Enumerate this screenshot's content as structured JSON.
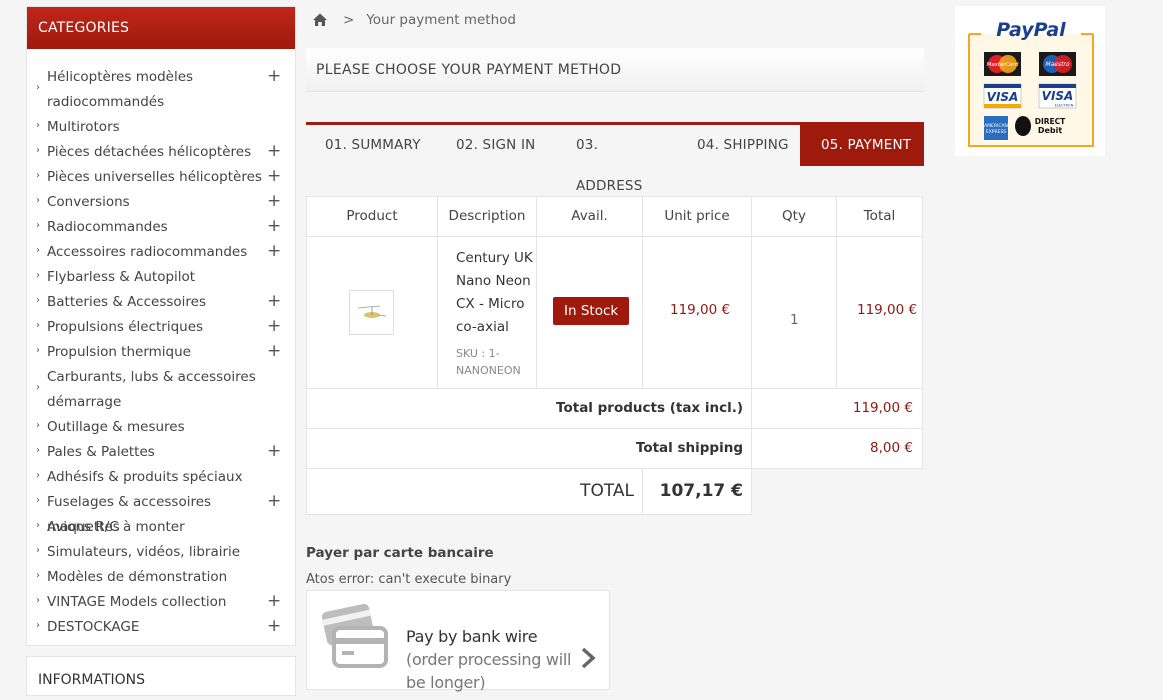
{
  "sidebar": {
    "categories_title": "CATEGORIES",
    "items": [
      {
        "label_lines": [
          "Hélicoptères modèles",
          "radiocommandés"
        ],
        "has_children": true
      },
      {
        "label_lines": [
          "Multirotors"
        ],
        "has_children": false
      },
      {
        "label_lines": [
          "Pièces détachées hélicoptères"
        ],
        "has_children": true
      },
      {
        "label_lines": [
          "Pièces universelles hélicoptères"
        ],
        "has_children": true
      },
      {
        "label_lines": [
          "Conversions"
        ],
        "has_children": true
      },
      {
        "label_lines": [
          "Radiocommandes"
        ],
        "has_children": true
      },
      {
        "label_lines": [
          "Accessoires radiocommandes"
        ],
        "has_children": true
      },
      {
        "label_lines": [
          "Flybarless & Autopilot"
        ],
        "has_children": false
      },
      {
        "label_lines": [
          "Batteries & Accessoires"
        ],
        "has_children": true
      },
      {
        "label_lines": [
          "Propulsions électriques"
        ],
        "has_children": true
      },
      {
        "label_lines": [
          "Propulsion thermique"
        ],
        "has_children": true
      },
      {
        "label_lines": [
          "Carburants, lubs & accessoires",
          "démarrage"
        ],
        "has_children": false
      },
      {
        "label_lines": [
          "Outillage & mesures"
        ],
        "has_children": false
      },
      {
        "label_lines": [
          "Pales & Palettes"
        ],
        "has_children": true
      },
      {
        "label_lines": [
          "Adhésifs & produits spéciaux"
        ],
        "has_children": false
      },
      {
        "label_lines": [
          "Fuselages & accessoires maquettes"
        ],
        "has_children": true
      },
      {
        "label_lines": [
          "Avions R/C à monter"
        ],
        "has_children": false
      },
      {
        "label_lines": [
          "Simulateurs, vidéos, librairie"
        ],
        "has_children": false
      },
      {
        "label_lines": [
          "Modèles de démonstration"
        ],
        "has_children": false
      },
      {
        "label_lines": [
          "VINTAGE Models collection"
        ],
        "has_children": true
      },
      {
        "label_lines": [
          "DESTOCKAGE"
        ],
        "has_children": true
      }
    ],
    "informations_title": "INFORMATIONS"
  },
  "breadcrumb": {
    "separator": ">",
    "current": "Your payment method"
  },
  "page_heading": "PLEASE CHOOSE YOUR PAYMENT METHOD",
  "steps": [
    {
      "label": "01. SUMMARY",
      "active": false
    },
    {
      "label": "02. SIGN IN",
      "active": false
    },
    {
      "label": "03. ADDRESS",
      "active": false
    },
    {
      "label": "04. SHIPPING",
      "active": false
    },
    {
      "label": "05. PAYMENT",
      "active": true
    }
  ],
  "cart": {
    "headers": {
      "product": "Product",
      "description": "Description",
      "avail": "Avail.",
      "unit_price": "Unit price",
      "qty": "Qty",
      "total": "Total"
    },
    "row": {
      "description_lines": [
        "Century UK",
        "Nano Neon",
        "CX - Micro",
        "co-axial"
      ],
      "sku_lines": [
        "SKU : 1-",
        "NANONEON"
      ],
      "availability": "In Stock",
      "unit_price": "119,00 €",
      "qty": "1",
      "total": "119,00 €"
    },
    "total_products_label": "Total products (tax incl.)",
    "total_products_value": "119,00 €",
    "total_shipping_label": "Total shipping",
    "total_shipping_value": "8,00 €",
    "total_label": "TOTAL",
    "total_value": "107,17 €"
  },
  "payment": {
    "card_title": "Payer par carte bancaire",
    "error_text": "Atos error: can't execute binary",
    "bankwire_label": "Pay by bank wire",
    "bankwire_sub": "(order processing will be longer)"
  },
  "paypal": {
    "brand": "PayPal",
    "cards": [
      "MasterCard",
      "Maestro",
      "VISA",
      "VISA ELECTRON",
      "AMERICAN EXPRESS",
      "DIRECT Debit"
    ]
  },
  "colors": {
    "accent": "#9e1a0c",
    "price": "#8b1a10",
    "paypal_border": "#f5a623"
  }
}
